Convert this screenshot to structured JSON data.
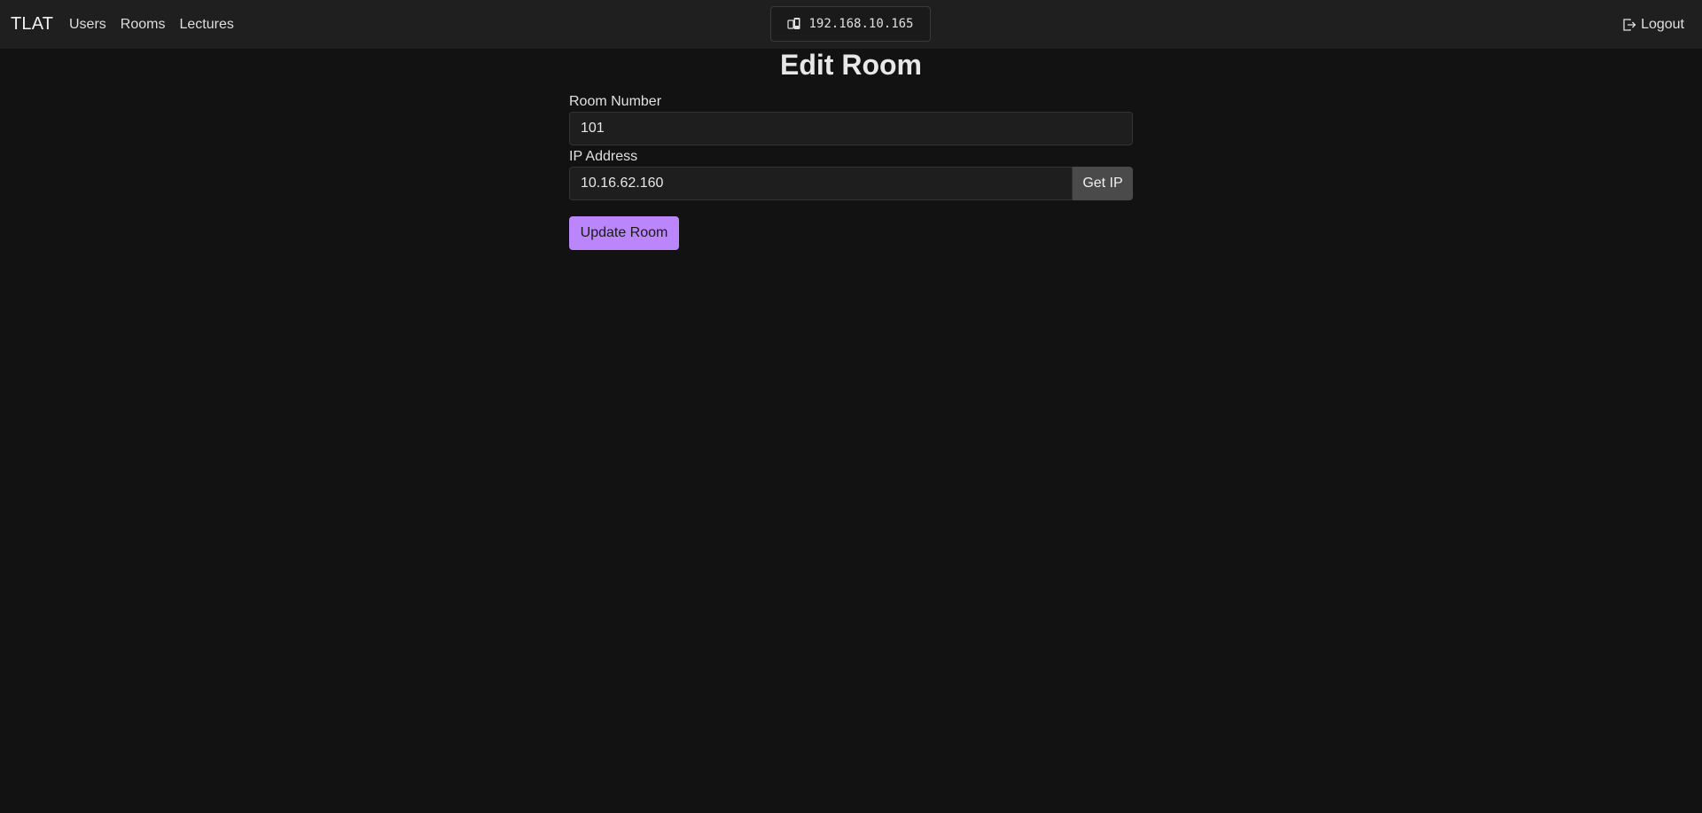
{
  "navbar": {
    "brand": "TLAT",
    "links": [
      {
        "label": "Users"
      },
      {
        "label": "Rooms"
      },
      {
        "label": "Lectures"
      }
    ],
    "device_ip": "192.168.10.165",
    "device_icon": "device-icon",
    "logout_label": "Logout",
    "logout_icon": "logout-icon"
  },
  "page": {
    "title": "Edit Room"
  },
  "form": {
    "room_number_label": "Room Number",
    "room_number_value": "101",
    "ip_address_label": "IP Address",
    "ip_address_value": "10.16.62.160",
    "get_ip_label": "Get IP",
    "submit_label": "Update Room"
  },
  "colors": {
    "background": "#121212",
    "navbar": "#1f1f1f",
    "accent": "#bb86fc",
    "secondary_button": "#4a4a4a"
  }
}
